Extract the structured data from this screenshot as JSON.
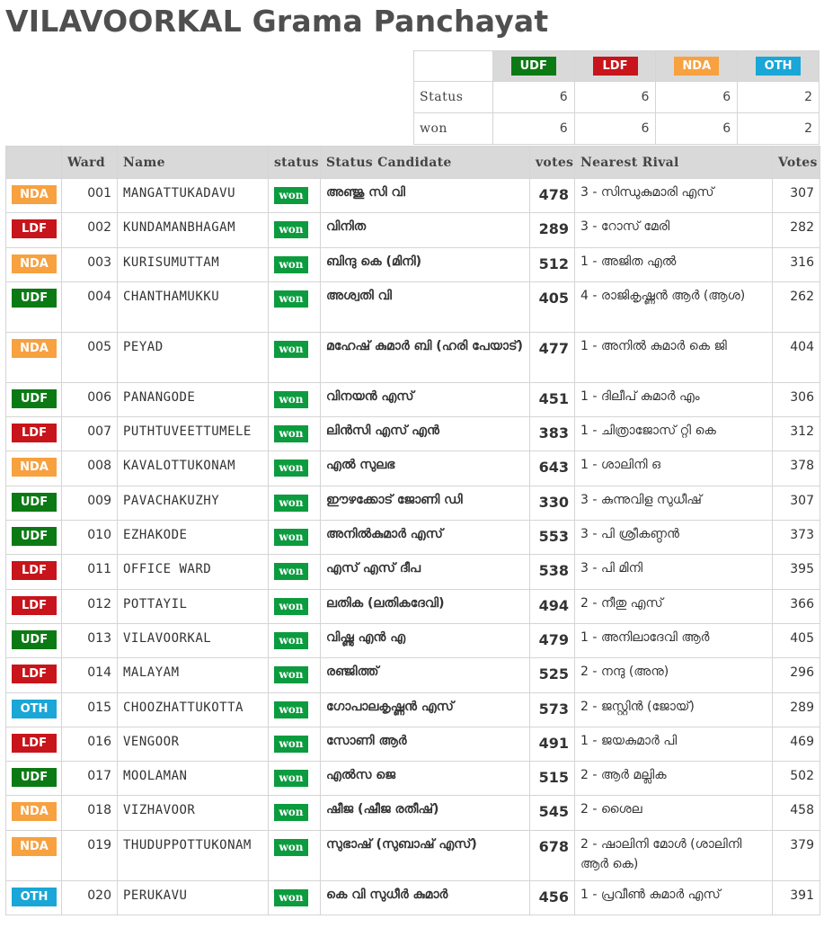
{
  "title": "VILAVOORKAL Grama Panchayat",
  "parties": [
    {
      "label": "UDF",
      "color": "#0c7a14"
    },
    {
      "label": "LDF",
      "color": "#c8141b"
    },
    {
      "label": "NDA",
      "color": "#f7a140"
    },
    {
      "label": "OTH",
      "color": "#1aa6d6"
    }
  ],
  "party_colors": {
    "UDF": "#0c7a14",
    "LDF": "#c8141b",
    "NDA": "#f7a140",
    "OTH": "#1aa6d6"
  },
  "summary": {
    "rows": [
      {
        "label": "Status",
        "values": [
          "6",
          "6",
          "6",
          "2"
        ]
      },
      {
        "label": "won",
        "values": [
          "6",
          "6",
          "6",
          "2"
        ]
      }
    ]
  },
  "columns": [
    "Ward",
    "Name",
    "status",
    "Status Candidate",
    "votes",
    "Nearest Rival",
    "Votes"
  ],
  "wards": [
    {
      "party": "NDA",
      "ward": "001",
      "name": "MANGATTUKADAVU",
      "status": "won",
      "candidate": "അഞ്ജു സി വി",
      "votes": "478",
      "rival": "3 - സിന്ധുകുമാരി എസ്",
      "rival_votes": "307"
    },
    {
      "party": "LDF",
      "ward": "002",
      "name": "KUNDAMANBHAGAM",
      "status": "won",
      "candidate": "വിനിത",
      "votes": "289",
      "rival": "3 - റോസ് മേരി",
      "rival_votes": "282"
    },
    {
      "party": "NDA",
      "ward": "003",
      "name": "KURISUMUTTAM",
      "status": "won",
      "candidate": "ബിന്ദു കെ (മിനി)",
      "votes": "512",
      "rival": "1 - അജിത എൽ",
      "rival_votes": "316"
    },
    {
      "party": "UDF",
      "ward": "004",
      "name": "CHANTHAMUKKU",
      "status": "won",
      "candidate": "അശ്വതി വി",
      "votes": "405",
      "rival": "4 - രാജികൃഷ്ണൻ ആർ (ആശ)",
      "rival_votes": "262"
    },
    {
      "party": "NDA",
      "ward": "005",
      "name": "PEYAD",
      "status": "won",
      "candidate": "മഹേഷ് കുമാർ ബി (ഹരി പേയാട്)",
      "votes": "477",
      "rival": "1 - അനിൽ കുമാർ കെ ജി",
      "rival_votes": "404"
    },
    {
      "party": "UDF",
      "ward": "006",
      "name": "PANANGODE",
      "status": "won",
      "candidate": "വിനയൻ എസ്",
      "votes": "451",
      "rival": "1 - ദിലീപ് കുമാർ എം",
      "rival_votes": "306"
    },
    {
      "party": "LDF",
      "ward": "007",
      "name": "PUTHTUVEETTUMELE",
      "status": "won",
      "candidate": "ലിൻസി എസ് എൻ",
      "votes": "383",
      "rival": "1 - ചിത്രാജോസ് റ്റി കെ",
      "rival_votes": "312"
    },
    {
      "party": "NDA",
      "ward": "008",
      "name": "KAVALOTTUKONAM",
      "status": "won",
      "candidate": "എൽ സുലഭ",
      "votes": "643",
      "rival": "1 - ശാലിനി ഒ",
      "rival_votes": "378"
    },
    {
      "party": "UDF",
      "ward": "009",
      "name": "PAVACHAKUZHY",
      "status": "won",
      "candidate": "ഈഴക്കോട് ജോണി ഡി",
      "votes": "330",
      "rival": "3 - കുന്നുവിള സുധീഷ്",
      "rival_votes": "307"
    },
    {
      "party": "UDF",
      "ward": "010",
      "name": "EZHAKODE",
      "status": "won",
      "candidate": "അനിൽകുമാർ എസ്",
      "votes": "553",
      "rival": "3 - പി ശ്രീകണ്ഠൻ",
      "rival_votes": "373"
    },
    {
      "party": "LDF",
      "ward": "011",
      "name": "OFFICE WARD",
      "status": "won",
      "candidate": "എസ് എസ് ദീപ",
      "votes": "538",
      "rival": "3 - പി മിനി",
      "rival_votes": "395"
    },
    {
      "party": "LDF",
      "ward": "012",
      "name": "POTTAYIL",
      "status": "won",
      "candidate": "ലതിക (ലതികദേവി)",
      "votes": "494",
      "rival": "2 - നീതു എസ്",
      "rival_votes": "366"
    },
    {
      "party": "UDF",
      "ward": "013",
      "name": "VILAVOORKAL",
      "status": "won",
      "candidate": "വിഷ്ണു എൻ എ",
      "votes": "479",
      "rival": "1 - അനിലാദേവി ആർ",
      "rival_votes": "405"
    },
    {
      "party": "LDF",
      "ward": "014",
      "name": "MALAYAM",
      "status": "won",
      "candidate": "രഞ്ജിത്ത്",
      "votes": "525",
      "rival": "2 - നന്ദു (അനു)",
      "rival_votes": "296"
    },
    {
      "party": "OTH",
      "ward": "015",
      "name": "CHOOZHATTUKOTTA",
      "status": "won",
      "candidate": "ഗോപാലകൃഷ്ണൻ എസ്",
      "votes": "573",
      "rival": "2 - ജസ്റ്റിൻ (ജോയ്)",
      "rival_votes": "289"
    },
    {
      "party": "LDF",
      "ward": "016",
      "name": "VENGOOR",
      "status": "won",
      "candidate": "സോണി ആർ",
      "votes": "491",
      "rival": "1 - ജയകുമാർ പി",
      "rival_votes": "469"
    },
    {
      "party": "UDF",
      "ward": "017",
      "name": "MOOLAMAN",
      "status": "won",
      "candidate": "എൽസ ജെ",
      "votes": "515",
      "rival": "2 - ആർ മല്ലിക",
      "rival_votes": "502"
    },
    {
      "party": "NDA",
      "ward": "018",
      "name": "VIZHAVOOR",
      "status": "won",
      "candidate": "ഷീജ (ഷീജ രതീഷ്)",
      "votes": "545",
      "rival": "2 - ശൈല",
      "rival_votes": "458"
    },
    {
      "party": "NDA",
      "ward": "019",
      "name": "THUDUPPOTTUKONAM",
      "status": "won",
      "candidate": "സുഭാഷ് (സുബാഷ് എസ്)",
      "votes": "678",
      "rival": "2 - ഷാലിനി മോൾ (ശാലിനി ആർ കെ)",
      "rival_votes": "379"
    },
    {
      "party": "OTH",
      "ward": "020",
      "name": "PERUKAVU",
      "status": "won",
      "candidate": "കെ വി സുധീർ കുമാർ",
      "votes": "456",
      "rival": "1 - പ്രവീൺ കുമാർ എസ്",
      "rival_votes": "391"
    }
  ]
}
